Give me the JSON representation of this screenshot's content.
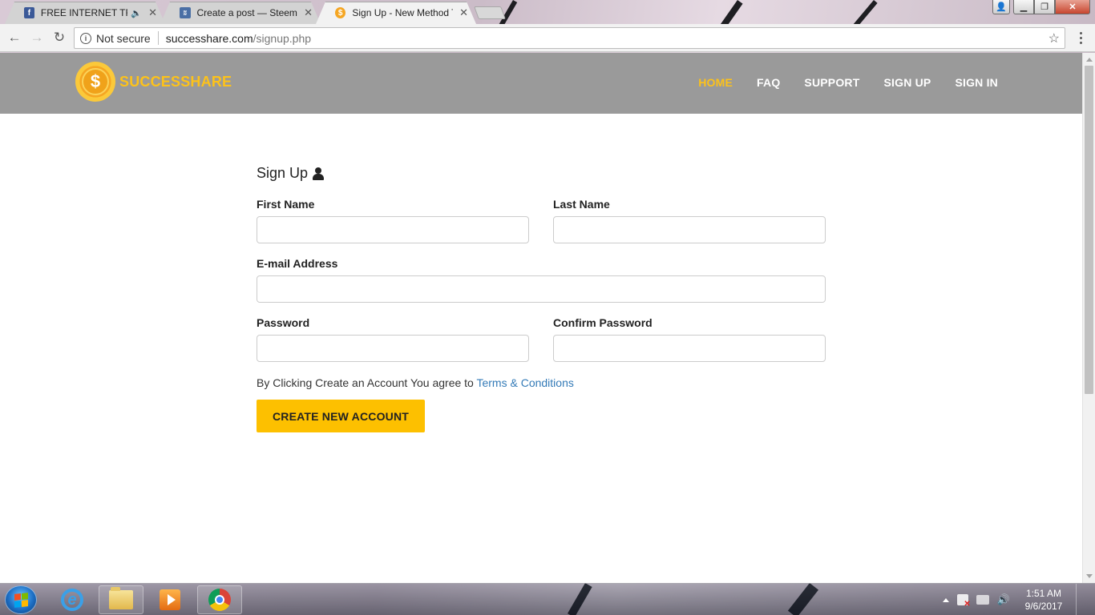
{
  "browser": {
    "tabs": [
      {
        "title": "FREE INTERNET TRICK",
        "favicon": "facebook-icon",
        "audio": true,
        "active": false
      },
      {
        "title": "Create a post — Steemit",
        "favicon": "steemit-icon",
        "audio": false,
        "active": false
      },
      {
        "title": "Sign Up - New Method T",
        "favicon": "coin-icon",
        "audio": false,
        "active": true
      }
    ],
    "security_label": "Not secure",
    "url_host": "successhare.com",
    "url_path": "/signup.php"
  },
  "site": {
    "brand": "SUCCESSHARE",
    "logo_glyph": "$",
    "nav": [
      {
        "label": "HOME",
        "active": true
      },
      {
        "label": "FAQ",
        "active": false
      },
      {
        "label": "SUPPORT",
        "active": false
      },
      {
        "label": "SIGN UP",
        "active": false
      },
      {
        "label": "SIGN IN",
        "active": false
      }
    ],
    "colors": {
      "header": "#9a9a9a",
      "accent": "#fdc21a",
      "button": "#fdc000",
      "link": "#337ab7"
    }
  },
  "form": {
    "title": "Sign Up",
    "first_name_label": "First Name",
    "first_name_value": "",
    "last_name_label": "Last Name",
    "last_name_value": "",
    "email_label": "E-mail Address",
    "email_value": "",
    "password_label": "Password",
    "password_value": "",
    "confirm_password_label": "Confirm Password",
    "confirm_password_value": "",
    "terms_text": "By Clicking Create an Account You agree to",
    "terms_link": "Terms & Conditions",
    "submit_label": "CREATE NEW ACCOUNT"
  },
  "taskbar": {
    "time": "1:51 AM",
    "date": "9/6/2017"
  }
}
